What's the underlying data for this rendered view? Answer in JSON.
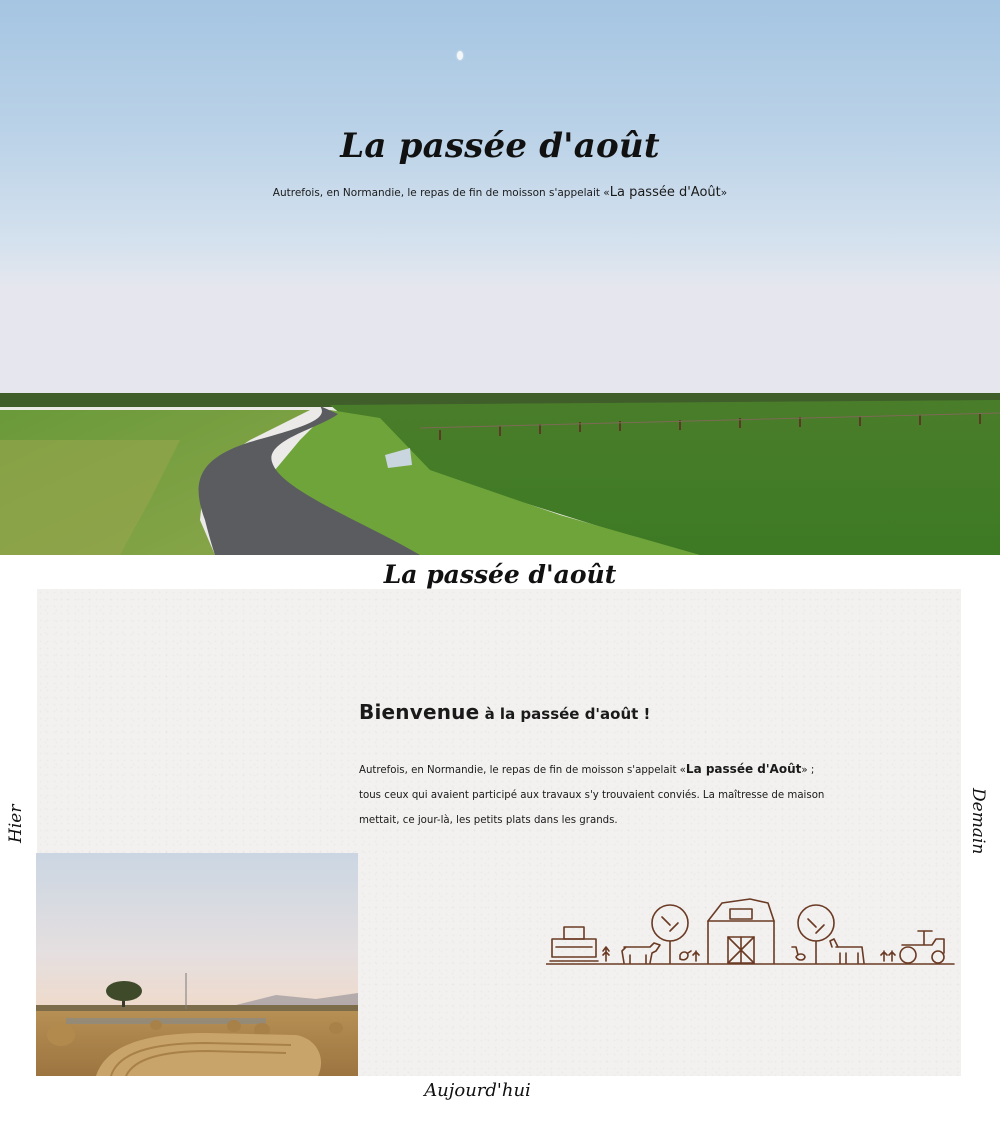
{
  "hero": {
    "title": "La passée d'août",
    "subtitle_prefix": "Autrefois, en Normandie, le repas de fin de moisson s'appelait «",
    "subtitle_highlight": "La passée d'Août",
    "subtitle_suffix": "»"
  },
  "section": {
    "title": "La passée d'août"
  },
  "welcome": {
    "strong": "Bienvenue",
    "rest": " à la passée d'août !"
  },
  "intro": {
    "part1": "Autrefois, en Normandie, le repas de fin de moisson s'appelait «",
    "highlight": "La passée d'Août",
    "part2": "» ; tous ceux qui avaient participé aux travaux s'y trouvaient conviés. La maîtresse de maison mettait, ce jour-là, les petits plats dans les grands."
  },
  "nav": {
    "left": "Hier",
    "right": "Demain",
    "bottom": "Aujourd'hui"
  },
  "images": {
    "hero": "countryside-road-photo",
    "field": "hay-bale-field-photo",
    "illustration": "farm-line-illustration"
  },
  "colors": {
    "sky_top": "#a7c7e3",
    "grass": "#4f8a2c",
    "paper": "#f2f1ef",
    "illustration": "#6b3a24"
  }
}
